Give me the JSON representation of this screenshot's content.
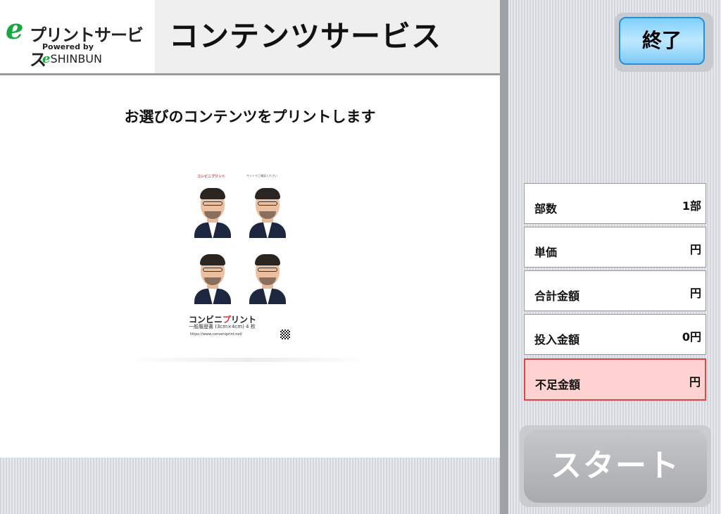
{
  "logo": {
    "text": "プリントサービス",
    "mark": "e",
    "powered_by": "Powered by",
    "powered_mark": "e",
    "brand": "SHINBUN"
  },
  "header": {
    "title": "コンテンツサービス"
  },
  "end_button": {
    "label": "終了"
  },
  "instruction": "お選びのコンテンツをプリントします",
  "preview": {
    "brand": "コンビニプリント",
    "note": "サイトでご確認ください",
    "title_prefix": "コンビニ",
    "title_red": "プ",
    "title_suffix": "リント",
    "subtitle": "一般履歴書 (3cm×4cm) 4 枚",
    "url": "https://www.conveniprint.net/"
  },
  "summary": [
    {
      "label": "部数",
      "value": "1部"
    },
    {
      "label": "単価",
      "value": "円"
    },
    {
      "label": "合計金額",
      "value": "円"
    },
    {
      "label": "投入金額",
      "value": "0円"
    },
    {
      "label": "不足金額",
      "value": "円"
    }
  ],
  "start_button": {
    "label": "スタート"
  },
  "colors": {
    "logo_green": "#1aa640",
    "end_button": "#7ed0ff",
    "alert_bg": "#ffd2d2",
    "alert_border": "#d84848"
  }
}
